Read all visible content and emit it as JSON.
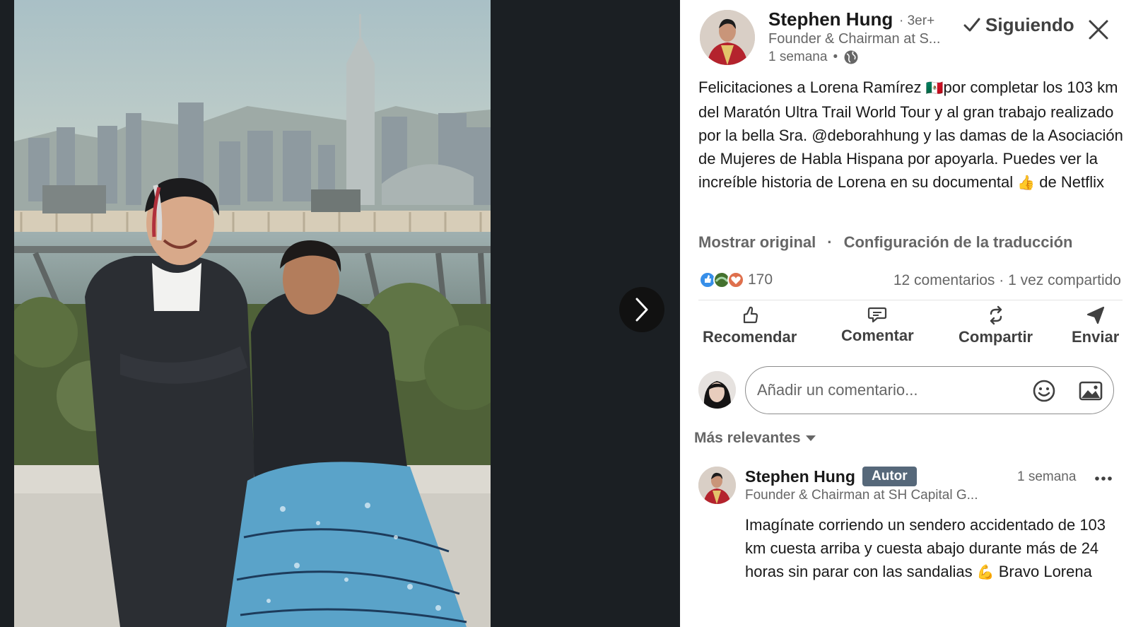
{
  "viewer": {
    "next_label": "Siguiente imagen"
  },
  "post": {
    "author": "Stephen Hung",
    "degree": "· 3er+",
    "headline": "Founder & Chairman at S...",
    "time": "1 semana",
    "time_sep": "•",
    "follow_label": "Siguiendo",
    "text_parts": [
      "Felicitaciones a Lorena Ramírez ",
      "🇲🇽",
      "por completar los 103 km del Maratón Ultra Trail World Tour y al gran trabajo realizado por la bella Sra. @deborahhung y las damas de la Asociación de Mujeres de Habla Hispana por apoyarla. Puedes ver la increíble historia de Lorena en su documental ",
      "👍",
      " de Netflix"
    ],
    "show_original": "Mostrar original",
    "dot_sep": "·",
    "translation_settings": "Configuración de la traducción",
    "reaction_count": "170",
    "comments_shares": "12 comentarios · 1 vez compartido"
  },
  "actions": {
    "like": "Recomendar",
    "comment": "Comentar",
    "share": "Compartir",
    "send": "Enviar"
  },
  "comment_box": {
    "placeholder": "Añadir un comentario..."
  },
  "sort": {
    "label": "Más relevantes"
  },
  "comments": [
    {
      "author": "Stephen Hung",
      "badge": "Autor",
      "time": "1 semana",
      "headline": "Founder & Chairman at SH Capital G...",
      "text_parts": [
        "Imagínate corriendo un sendero accidentado de 103 km cuesta arriba y cuesta abajo durante más de 24 horas sin parar con las sandalias ",
        "💪",
        " Bravo Lorena"
      ]
    }
  ],
  "colors": {
    "accent_text": "#191919",
    "muted_text": "#666666",
    "badge_bg": "#56687a",
    "viewer_bg": "#1b1f23"
  },
  "icons": {
    "close": "close-icon",
    "globe": "globe-icon",
    "check": "check-icon",
    "next": "chevron-right-icon",
    "like": "thumbs-up-icon",
    "comment": "comment-icon",
    "share": "repost-icon",
    "send": "send-icon",
    "emoji": "emoji-icon",
    "image": "image-icon",
    "caret": "caret-down-icon",
    "more": "ellipsis-icon"
  }
}
